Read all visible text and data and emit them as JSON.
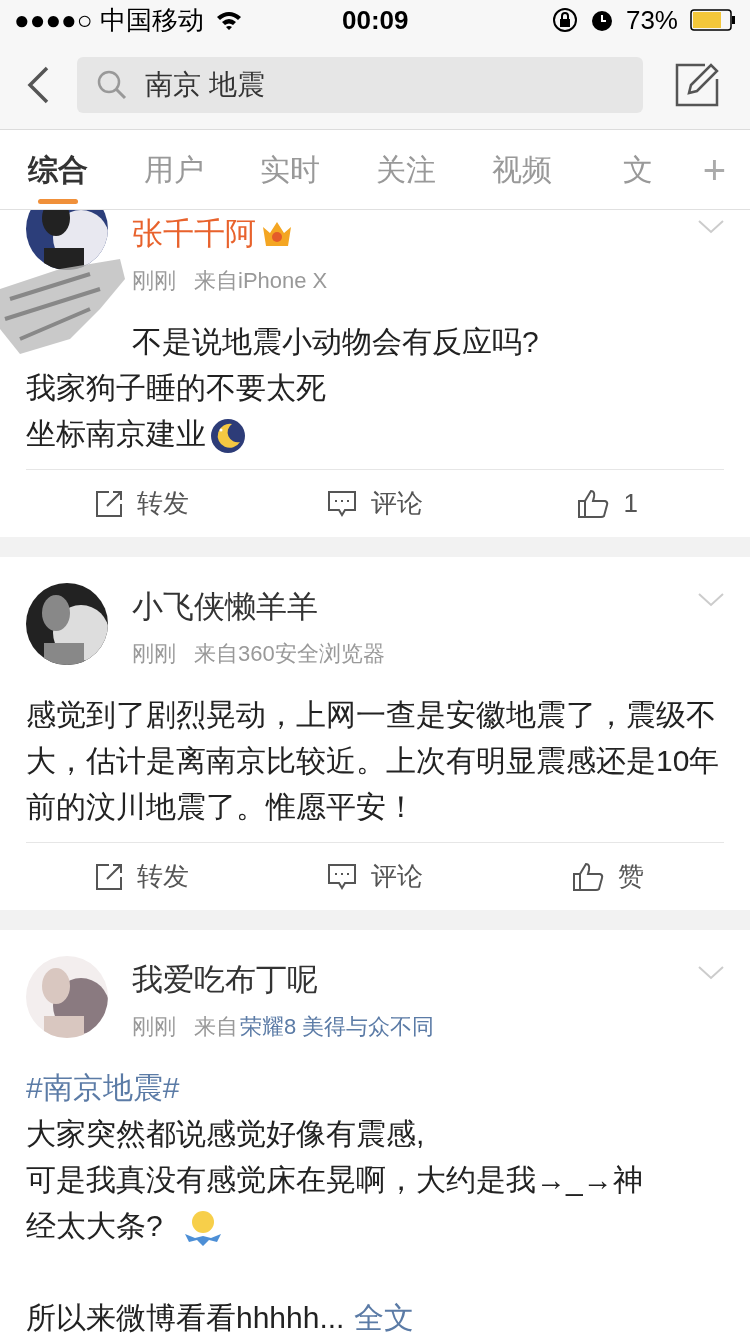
{
  "status_bar": {
    "carrier": "●●●●○ 中国移动",
    "time": "00:09",
    "battery": "73%"
  },
  "search": {
    "value": "南京 地震"
  },
  "tabs": [
    {
      "label": "综合",
      "selected": true
    },
    {
      "label": "用户",
      "selected": false
    },
    {
      "label": "实时",
      "selected": false
    },
    {
      "label": "关注",
      "selected": false
    },
    {
      "label": "视频",
      "selected": false
    },
    {
      "label": "文",
      "selected": false
    }
  ],
  "add_tab": "+",
  "posts": [
    {
      "name": "张千千阿",
      "vip": true,
      "time": "刚刚",
      "source": "来自iPhone X",
      "lines": [
        {
          "kind": "obscured",
          "text": "不是说地震小动物会有反应吗?"
        },
        {
          "kind": "text",
          "text": "我家狗子睡的不要太死"
        },
        {
          "kind": "text",
          "text": "坐标南京建业",
          "emoji": true
        }
      ],
      "repost": "转发",
      "comment": "评论",
      "like": "1"
    },
    {
      "name": "小飞侠懒羊羊",
      "vip": false,
      "time": "刚刚",
      "source": "来自360安全浏览器",
      "lines": [
        {
          "kind": "text",
          "text": "感觉到了剧烈晃动，上网一查是安徽地震了，震级不大，估计是离南京比较近。上次有明显震感还是10年前的汶川地震了。惟愿平安！"
        }
      ],
      "repost": "转发",
      "comment": "评论",
      "like": "赞"
    },
    {
      "name": "我爱吃布丁呢",
      "vip": false,
      "time": "刚刚",
      "source": "来自",
      "source_link": "荣耀8 美得与众不同",
      "lines": [
        {
          "kind": "hashtag",
          "text": "#南京地震#"
        },
        {
          "kind": "text",
          "text": "大家突然都说感觉好像有震感,"
        },
        {
          "kind": "text",
          "text": "可是我真没有感觉床在晃啊，大约是我→_→神"
        },
        {
          "kind": "text",
          "text": "经太大条?",
          "emoji": true
        },
        {
          "kind": "blank"
        },
        {
          "kind": "more",
          "text": "所以来微博看看hhhhh...",
          "link": "全文"
        }
      ]
    }
  ]
}
